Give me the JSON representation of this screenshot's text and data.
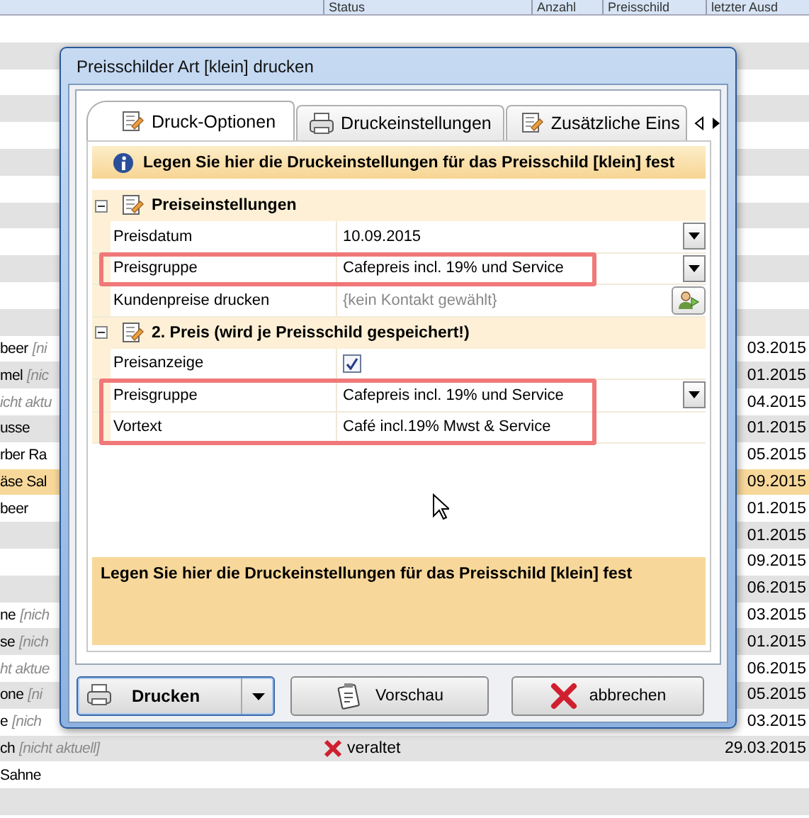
{
  "background_table": {
    "columns": [
      "Status",
      "Anzahl",
      "Preisschild",
      "letzter Ausd"
    ],
    "rows": [
      {
        "name": "beer",
        "note": "[ni",
        "date": "03.2015",
        "selected": false
      },
      {
        "name": "mel",
        "note": "[nic",
        "date": "01.2015",
        "selected": false
      },
      {
        "note": "icht aktu",
        "date": "04.2015",
        "selected": false
      },
      {
        "name": "usse",
        "date": "01.2015",
        "selected": false
      },
      {
        "name": "rber Ra",
        "date": "05.2015",
        "selected": false
      },
      {
        "name": "äse Sal",
        "date": "09.2015",
        "selected": true
      },
      {
        "name": "beer",
        "date": "01.2015",
        "selected": false
      },
      {
        "date": "01.2015",
        "selected": false
      },
      {
        "date": "09.2015",
        "selected": false
      },
      {
        "date": "06.2015",
        "selected": false
      },
      {
        "name": "ne",
        "note": "[nich",
        "date": "03.2015",
        "selected": false
      },
      {
        "name": "se",
        "note": "[nich",
        "date": "01.2015",
        "selected": false
      },
      {
        "note": "ht aktue",
        "date": "06.2015",
        "selected": false
      },
      {
        "name": "one",
        "note": "[ni",
        "date": "05.2015",
        "selected": false
      },
      {
        "name": "e",
        "note": "[nich",
        "date": "03.2015",
        "selected": false
      },
      {
        "name": "ch",
        "note": "[nicht aktuell]",
        "status": "veraltet",
        "date": "29.03.2015",
        "selected": false
      },
      {
        "name": "Sahne",
        "selected": false
      }
    ]
  },
  "dialog": {
    "title": "Preisschilder Art [klein] drucken",
    "tabs": [
      {
        "label": "Druck-Optionen",
        "selected": true
      },
      {
        "label": "Druckeinstellungen",
        "selected": false
      },
      {
        "label": "Zusätzliche Eins",
        "selected": false
      }
    ],
    "info_header": "Legen Sie hier die Druckeinstellungen für das Preisschild [klein] fest",
    "sections": [
      {
        "title": "Preiseinstellungen",
        "expanded": true,
        "rows": [
          {
            "label": "Preisdatum",
            "value": "10.09.2015",
            "kind": "dropdown",
            "highlighted": false
          },
          {
            "label": "Preisgruppe",
            "value": "Cafepreis incl.  19% und Service",
            "kind": "dropdown",
            "highlighted": true
          },
          {
            "label": "Kundenpreise drucken",
            "value": "{kein Kontakt gewählt}",
            "kind": "picker",
            "highlighted": false
          }
        ]
      },
      {
        "title": "2. Preis (wird je Preisschild gespeichert!)",
        "expanded": true,
        "rows": [
          {
            "label": "Preisanzeige",
            "kind": "checkbox",
            "checked": true,
            "highlighted": false
          },
          {
            "label": "Preisgruppe",
            "value": "Cafepreis incl.  19% und Service",
            "kind": "dropdown",
            "highlighted": true
          },
          {
            "label": "Vortext",
            "value": "Café incl.19% Mwst & Service",
            "kind": "text",
            "highlighted": true
          }
        ]
      }
    ],
    "description": "Legen Sie hier die Druckeinstellungen für das Preisschild [klein] fest",
    "buttons": [
      {
        "label": "Drucken",
        "kind": "split"
      },
      {
        "label": "Vorschau",
        "kind": "plain"
      },
      {
        "label": "abbrechen",
        "kind": "plain"
      }
    ]
  }
}
